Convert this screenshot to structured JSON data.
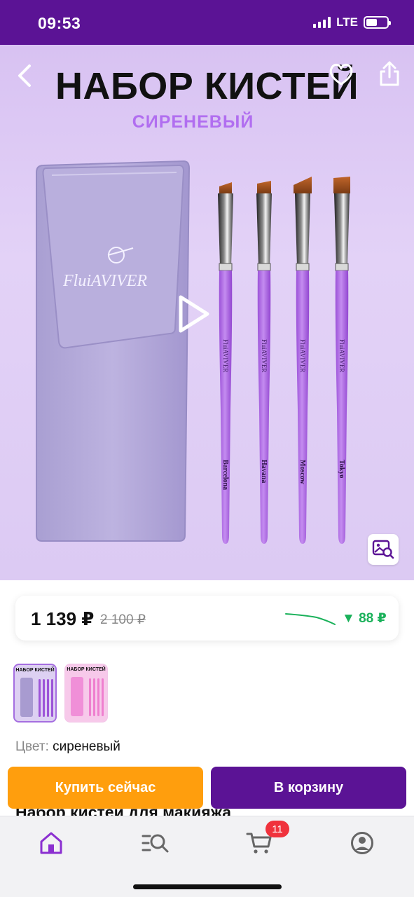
{
  "status_bar": {
    "time": "09:53",
    "network": "LTE"
  },
  "hero": {
    "title": "НАБОР КИСТЕЙ",
    "subtitle": "СИРЕНЕВЫЙ",
    "brand": "FluiAVIVER",
    "brush_names": [
      "Barcelona",
      "Havana",
      "Moscow",
      "Tokyo"
    ]
  },
  "price": {
    "current": "1 139 ₽",
    "old": "2 100 ₽",
    "drop": "▼ 88 ₽"
  },
  "variants": [
    {
      "title": "НАБОР КИСТЕЙ",
      "color": "#ddd0f2"
    },
    {
      "title": "НАБОР КИСТЕЙ",
      "color": "#f7c9ea"
    }
  ],
  "color": {
    "label": "Цвет:",
    "value": "сиреневый"
  },
  "actions": {
    "buy_now": "Купить сейчас",
    "add_to_cart": "В корзину"
  },
  "product_title_peek": "Набор кистей для макияжа",
  "nav": {
    "items": [
      {
        "icon": "home-icon",
        "active": true
      },
      {
        "icon": "catalog-search-icon",
        "active": false
      },
      {
        "icon": "cart-icon",
        "active": false
      },
      {
        "icon": "profile-icon",
        "active": false
      }
    ],
    "cart_badge": "11"
  },
  "colors": {
    "brand": "#5b1395",
    "accent": "#ff9e0d",
    "price_drop": "#1ab15a",
    "badge": "#f0323c"
  }
}
